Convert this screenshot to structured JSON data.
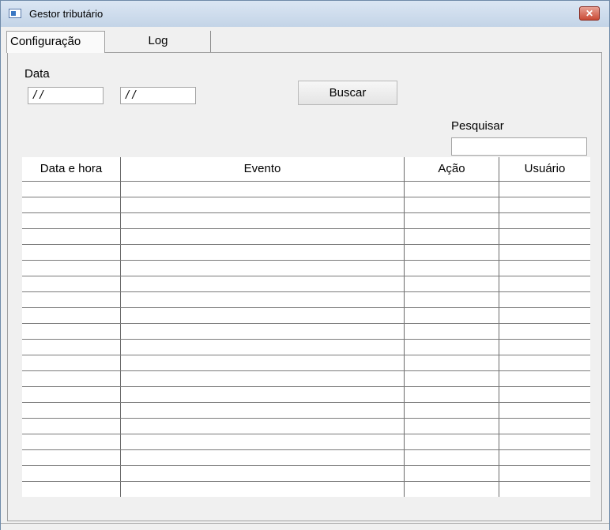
{
  "window": {
    "title": "Gestor tributário",
    "close_glyph": "✕"
  },
  "tabs": [
    {
      "label": "Configuração",
      "active": true
    },
    {
      "label": "Log",
      "active": false
    }
  ],
  "filters": {
    "date_label": "Data",
    "date_from_value": "/ /",
    "date_to_value": "/ /",
    "search_button_label": "Buscar",
    "search_label": "Pesquisar",
    "search_value": ""
  },
  "table": {
    "columns": [
      "Data e hora",
      "Evento",
      "Ação",
      "Usuário"
    ],
    "rows": []
  }
}
